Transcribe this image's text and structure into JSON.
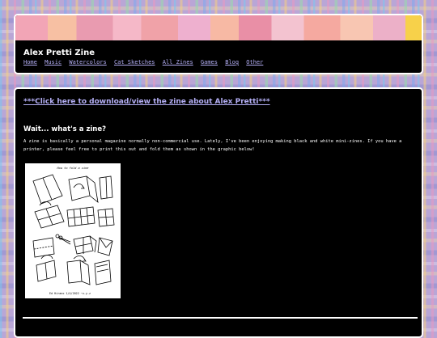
{
  "site": {
    "title": "Alex Pretti Zine",
    "nav": [
      "Home",
      "Music",
      "Watercolors",
      "Cat Sketches",
      "All Zines",
      "Games",
      "Blog",
      "Other"
    ]
  },
  "main": {
    "download_link": "***Click here to download/view the zine about Alex Pretti***",
    "section_heading": "Wait... what's a zine?",
    "intro": "A zine is basically a personal magazine normally non-commercial use. Lately, I've been enjoying making black and white mini-zines. If you have a printer, please feel free to print this out and fold them as shown in the graphic below!",
    "graphic": {
      "title": "How to fold a zine",
      "signature": "Ed Hirano 1/4/2022 ~x.y.z"
    }
  },
  "colors": {
    "link": "#b3aef4",
    "card_bg": "#000000",
    "card_border": "#ffffff",
    "accent": "#f7d14a"
  }
}
